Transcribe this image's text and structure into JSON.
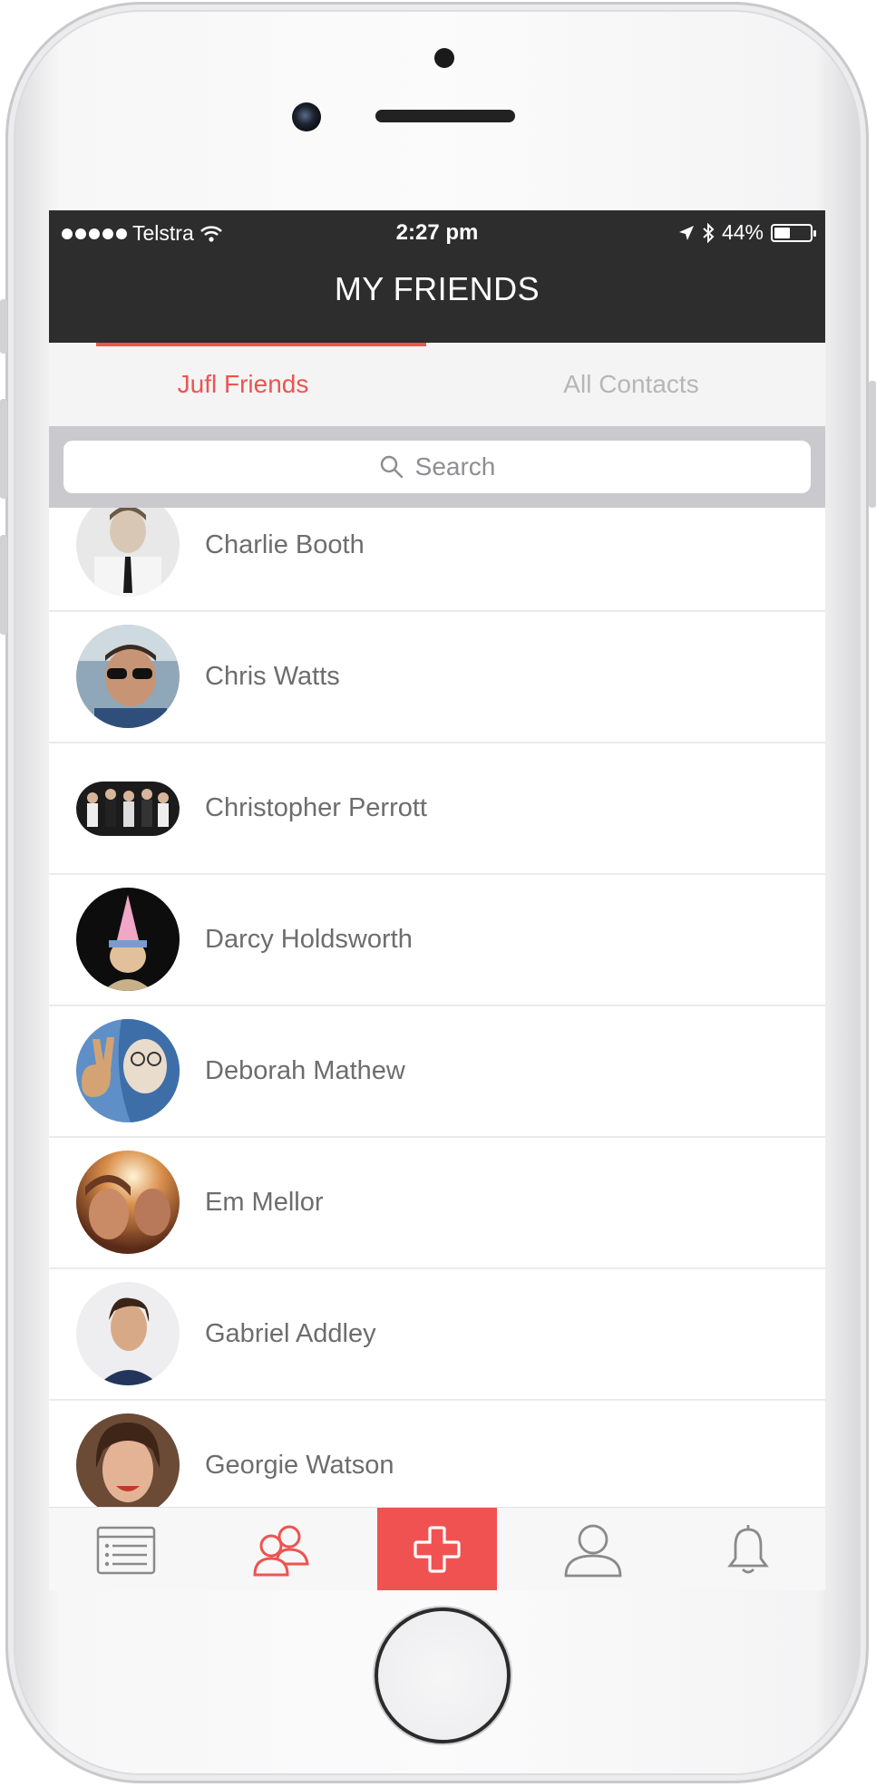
{
  "status_bar": {
    "carrier": "Telstra",
    "time": "2:27 pm",
    "battery": "44%",
    "battery_level": 0.44
  },
  "header": {
    "title": "MY FRIENDS"
  },
  "tabs": [
    {
      "label": "Jufl Friends",
      "active": true
    },
    {
      "label": "All Contacts",
      "active": false
    }
  ],
  "search": {
    "placeholder": "Search"
  },
  "friends": [
    {
      "name": "Charlie Booth"
    },
    {
      "name": "Chris Watts"
    },
    {
      "name": "Christopher Perrott"
    },
    {
      "name": "Darcy Holdsworth"
    },
    {
      "name": "Deborah Mathew"
    },
    {
      "name": "Em Mellor"
    },
    {
      "name": "Gabriel Addley"
    },
    {
      "name": "Georgie Watson"
    }
  ],
  "bottom_nav": [
    {
      "icon": "calendar-list-icon",
      "active": false
    },
    {
      "icon": "friends-icon",
      "active": true
    },
    {
      "icon": "plus-icon",
      "active": false
    },
    {
      "icon": "profile-icon",
      "active": false
    },
    {
      "icon": "bell-icon",
      "active": false
    }
  ],
  "colors": {
    "accent": "#ef5350",
    "header_bg": "#2d2d2d",
    "inactive_tab": "#b6b6b6"
  }
}
